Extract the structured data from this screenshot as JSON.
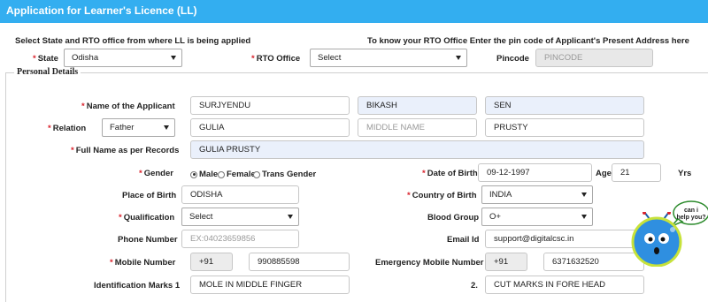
{
  "header": {
    "title": "Application for Learner's Licence (LL)"
  },
  "intro": {
    "left_text": "Select State and RTO office from where LL is being applied",
    "right_text": "To know your RTO Office Enter the pin code of Applicant's Present Address here"
  },
  "top": {
    "state_label": "State",
    "state_value": "Odisha",
    "rto_label": "RTO Office",
    "rto_value": "Select",
    "pincode_label": "Pincode",
    "pincode_placeholder": "PINCODE"
  },
  "section": {
    "legend": "Personal Details"
  },
  "form": {
    "name_label": "Name of the Applicant",
    "first_name": "SURJYENDU",
    "middle_name": "BIKASH",
    "last_name": "SEN",
    "relation_label": "Relation",
    "relation_value": "Father",
    "rel_first": "GULIA",
    "rel_middle_placeholder": "MIDDLE NAME",
    "rel_last": "PRUSTY",
    "fullname_label": "Full Name as per Records",
    "fullname_value": "GULIA PRUSTY",
    "gender_label": "Gender",
    "gender_options": [
      "Male",
      "Female",
      "Trans Gender"
    ],
    "gender_selected": "Male",
    "dob_label": "Date of Birth",
    "dob_value": "09-12-1997",
    "age_label": "Age",
    "age_value": "21",
    "age_unit": "Yrs",
    "pob_label": "Place of Birth",
    "pob_value": "ODISHA",
    "country_label": "Country of Birth",
    "country_value": "INDIA",
    "qual_label": "Qualification",
    "qual_value": "Select",
    "blood_label": "Blood Group",
    "blood_value": "O+",
    "phone_label": "Phone Number",
    "phone_placeholder": "EX:04023659856",
    "email_label": "Email Id",
    "email_value": "support@digitalcsc.in",
    "mobile_label": "Mobile Number",
    "mobile_code": "+91",
    "mobile_value": "990885598",
    "emergency_label": "Emergency Mobile Number",
    "emergency_code": "+91",
    "emergency_value": "6371632520",
    "idmark_label": "Identification Marks 1",
    "idmark1_value": "MOLE IN MIDDLE FINGER",
    "idmark2_label": "2.",
    "idmark2_value": "CUT MARKS IN FORE HEAD"
  },
  "help": {
    "text": "can i help you?"
  },
  "colors": {
    "header_bg": "#33aef0",
    "required": "#d9232d",
    "mascot": "#2f8fe0"
  }
}
